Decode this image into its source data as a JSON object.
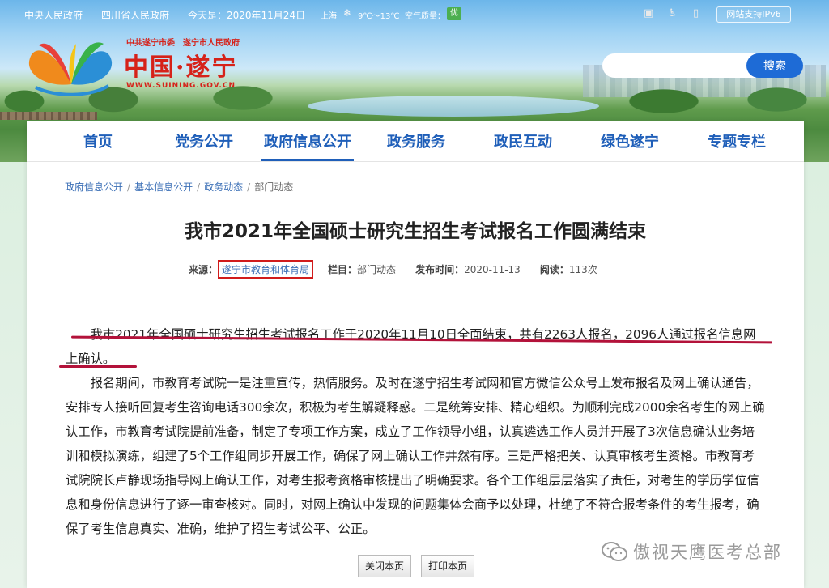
{
  "topbar": {
    "link_central": "中央人民政府",
    "link_province": "四川省人民政府",
    "date": "今天是：2020年11月24日",
    "city": "上海",
    "weather_icon": "snow-cloud-icon",
    "temperature": "9℃～13℃",
    "air_quality_label": "空气质量：",
    "air_quality_value": "优",
    "ipv6_label": "网站支持IPv6"
  },
  "logo": {
    "subtitle": "中共遂宁市委　遂宁市人民政府",
    "title": "中国·遂宁",
    "url": "WWW.SUINING.GOV.CN"
  },
  "search": {
    "placeholder": "",
    "button_label": "搜索"
  },
  "nav": {
    "items": [
      {
        "label": "首页"
      },
      {
        "label": "党务公开"
      },
      {
        "label": "政府信息公开"
      },
      {
        "label": "政务服务"
      },
      {
        "label": "政民互动"
      },
      {
        "label": "绿色遂宁"
      },
      {
        "label": "专题专栏"
      }
    ],
    "active_index": 2
  },
  "breadcrumb": {
    "items": [
      "政府信息公开",
      "基本信息公开",
      "政务动态"
    ],
    "current": "部门动态"
  },
  "article": {
    "title": "我市2021年全国硕士研究生招生考试报名工作圆满结束",
    "meta": {
      "source_label": "来源：",
      "source_value": "遂宁市教育和体育局",
      "column_label": "栏目：",
      "column_value": "部门动态",
      "date_label": "发布时间：",
      "date_value": "2020-11-13",
      "reads_label": "阅读：",
      "reads_value": "113次"
    },
    "paragraphs": [
      "我市2021年全国硕士研究生招生考试报名工作于2020年11月10日全面结束，共有2263人报名，2096人通过报名信息网上确认。",
      "报名期间，市教育考试院一是注重宣传，热情服务。及时在遂宁招生考试网和官方微信公众号上发布报名及网上确认通告，安排专人接听回复考生咨询电话300余次，积极为考生解疑释惑。二是统筹安排、精心组织。为顺利完成2000余名考生的网上确认工作，市教育考试院提前准备，制定了专项工作方案，成立了工作领导小组，认真遴选工作人员并开展了3次信息确认业务培训和模拟演练，组建了5个工作组同步开展工作，确保了网上确认工作井然有序。三是严格把关、认真审核考生资格。市教育考试院院长卢静现场指导网上确认工作，对考生报考资格审核提出了明确要求。各个工作组层层落实了责任，对考生的学历学位信息和身份信息进行了逐一审查核对。同时，对网上确认中发现的问题集体会商予以处理，杜绝了不符合报考条件的考生报考，确保了考生信息真实、准确，维护了招生考试公平、公正。"
    ]
  },
  "buttons": {
    "close_label": "关闭本页",
    "print_label": "打印本页"
  },
  "watermark": {
    "icon": "wechat-icon",
    "text": "傲视天鹰医考总部"
  },
  "colors": {
    "nav_blue": "#1f5fb9",
    "logo_red": "#d6221a",
    "search_blue": "#1e6bd6",
    "highlight_red": "#b3123a",
    "source_box_red": "#d11b1b"
  }
}
